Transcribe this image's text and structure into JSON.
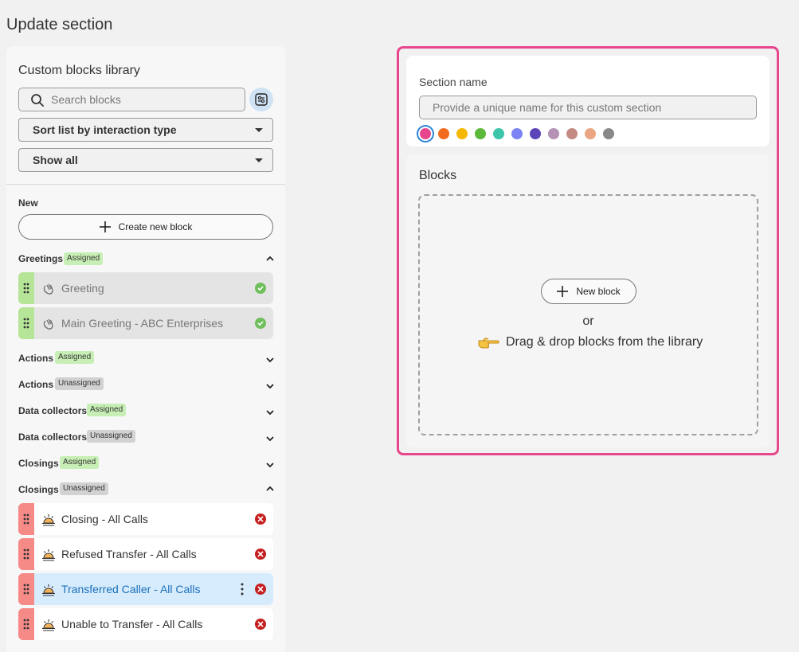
{
  "page": {
    "title": "Update section"
  },
  "library": {
    "title": "Custom blocks library",
    "search_placeholder": "Search blocks",
    "sort_select": "Sort list by interaction type",
    "filter_select": "Show all",
    "new_group_label": "New",
    "create_label": "Create new block",
    "groups": [
      {
        "name": "Greetings",
        "tag": "Assigned",
        "expanded": true,
        "blocks": [
          {
            "label": "Greeting",
            "status": "assigned"
          },
          {
            "label": "Main Greeting - ABC Enterprises",
            "status": "assigned"
          }
        ]
      },
      {
        "name": "Actions",
        "tag": "Assigned",
        "expanded": false
      },
      {
        "name": "Actions",
        "tag": "Unassigned",
        "expanded": false
      },
      {
        "name": "Data collectors",
        "tag": "Assigned",
        "expanded": false
      },
      {
        "name": "Data collectors",
        "tag": "Unassigned",
        "expanded": false
      },
      {
        "name": "Closings",
        "tag": "Assigned",
        "expanded": false
      },
      {
        "name": "Closings",
        "tag": "Unassigned",
        "expanded": true,
        "blocks": [
          {
            "label": "Closing - All Calls",
            "status": "unassigned"
          },
          {
            "label": "Refused Transfer - All Calls",
            "status": "unassigned"
          },
          {
            "label": "Transferred Caller - All Calls",
            "status": "unassigned",
            "selected": true
          },
          {
            "label": "Unable to Transfer - All Calls",
            "status": "unassigned"
          }
        ]
      }
    ]
  },
  "editor": {
    "section_name_label": "Section name",
    "section_name_placeholder": "Provide a unique name for this custom section",
    "colors": [
      "#e8468c",
      "#f26a1b",
      "#f5b800",
      "#5cb83a",
      "#3cc5a9",
      "#7b83f5",
      "#5a44b8",
      "#b592b5",
      "#c58a84",
      "#eba583",
      "#888888"
    ],
    "selected_color": "#e8468c",
    "blocks_title": "Blocks",
    "new_block_label": "New block",
    "or_label": "or",
    "drag_hint": "Drag & drop blocks from the library"
  },
  "theme": {
    "accent": "#e8468c",
    "selected_row": "#d6ecfd",
    "assigned_handle": "#b6e597",
    "unassigned_handle": "#f58a87"
  }
}
